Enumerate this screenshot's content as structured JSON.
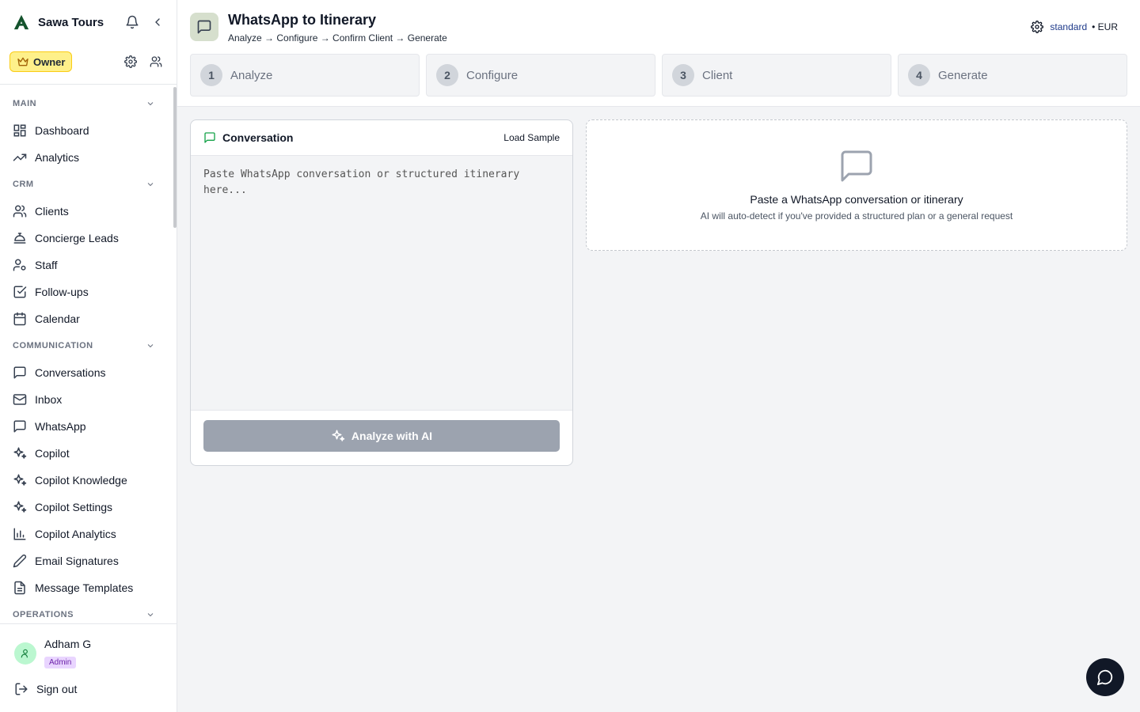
{
  "sidebar": {
    "brand": "Sawa Tours",
    "owner_badge": "Owner",
    "sections": {
      "main": "MAIN",
      "crm": "CRM",
      "communication": "COMMUNICATION",
      "operations": "OPERATIONS"
    },
    "items": {
      "dashboard": "Dashboard",
      "analytics": "Analytics",
      "clients": "Clients",
      "concierge": "Concierge Leads",
      "staff": "Staff",
      "followups": "Follow-ups",
      "calendar": "Calendar",
      "conversations": "Conversations",
      "inbox": "Inbox",
      "whatsapp": "WhatsApp",
      "copilot": "Copilot",
      "copilot_knowledge": "Copilot Knowledge",
      "copilot_settings": "Copilot Settings",
      "copilot_analytics": "Copilot Analytics",
      "email_signatures": "Email Signatures",
      "message_templates": "Message Templates"
    },
    "user": {
      "name": "Adham G",
      "role": "Admin"
    },
    "sign_out": "Sign out"
  },
  "header": {
    "title": "WhatsApp to Itinerary",
    "subtitle": "Analyze → Configure → Confirm Client → Generate",
    "tier": "standard",
    "currency": "• EUR"
  },
  "steps": [
    {
      "num": "1",
      "label": "Analyze"
    },
    {
      "num": "2",
      "label": "Configure"
    },
    {
      "num": "3",
      "label": "Client"
    },
    {
      "num": "4",
      "label": "Generate"
    }
  ],
  "conversation": {
    "title": "Conversation",
    "load_sample": "Load Sample",
    "placeholder": "Paste WhatsApp conversation or structured itinerary here...",
    "analyze_button": "Analyze with AI"
  },
  "empty_state": {
    "title": "Paste a WhatsApp conversation or itinerary",
    "description": "AI will auto-detect if you've provided a structured plan or a general request"
  },
  "colors": {
    "owner_badge_bg": "#fef08a",
    "header_icon_bg": "#d6dfcd",
    "analyze_button_bg": "#9ca3af",
    "accent_green": "#16a34a",
    "fab_bg": "#111827"
  }
}
